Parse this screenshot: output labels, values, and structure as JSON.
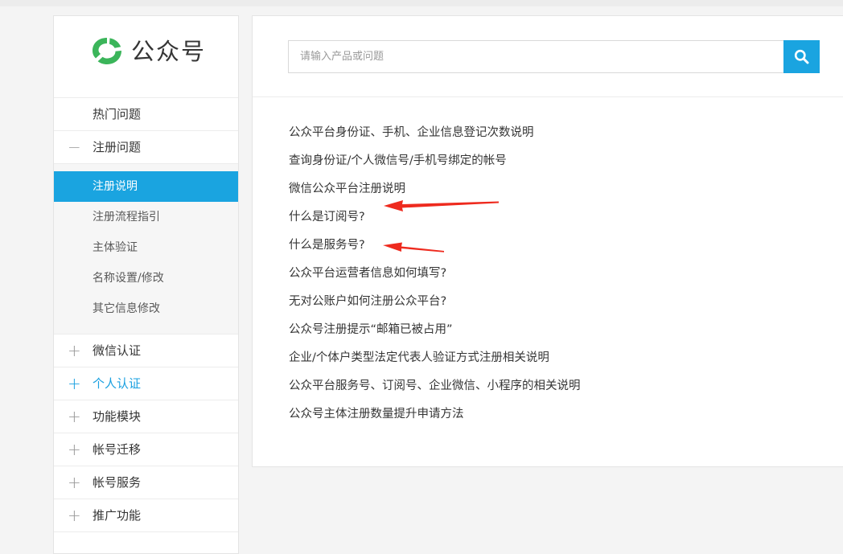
{
  "brand": {
    "name": "公众号",
    "icon": "wechat-mp-logo-icon",
    "accent": "#1aa4e0",
    "logo_color": "#3bb55a"
  },
  "sidebar": {
    "top_items": [
      {
        "label": "热门问题",
        "sign": ""
      },
      {
        "label": "注册问题",
        "sign": "−"
      }
    ],
    "sub_items": [
      {
        "label": "注册说明",
        "selected": true
      },
      {
        "label": "注册流程指引"
      },
      {
        "label": "主体验证"
      },
      {
        "label": "名称设置/修改"
      },
      {
        "label": "其它信息修改"
      }
    ],
    "groups": [
      {
        "label": "微信认证",
        "sign": "+"
      },
      {
        "label": "个人认证",
        "sign": "+"
      },
      {
        "label": "功能模块",
        "sign": "+"
      },
      {
        "label": "帐号迁移",
        "sign": "+"
      },
      {
        "label": "帐号服务",
        "sign": "+"
      },
      {
        "label": "推广功能",
        "sign": "+"
      }
    ]
  },
  "search": {
    "placeholder": "请输入产品或问题",
    "value": "",
    "icon": "search-icon"
  },
  "faq": [
    "公众平台身份证、手机、企业信息登记次数说明",
    "查询身份证/个人微信号/手机号绑定的帐号",
    "微信公众平台注册说明",
    "什么是订阅号?",
    "什么是服务号?",
    "公众平台运营者信息如何填写?",
    "无对公账户如何注册公众平台?",
    "公众号注册提示“邮箱已被占用”",
    "企业/个体户类型法定代表人验证方式注册相关说明",
    "公众平台服务号、订阅号、企业微信、小程序的相关说明",
    "公众号主体注册数量提升申请方法"
  ],
  "annotations": {
    "arrow_color": "#ee2a1e"
  }
}
